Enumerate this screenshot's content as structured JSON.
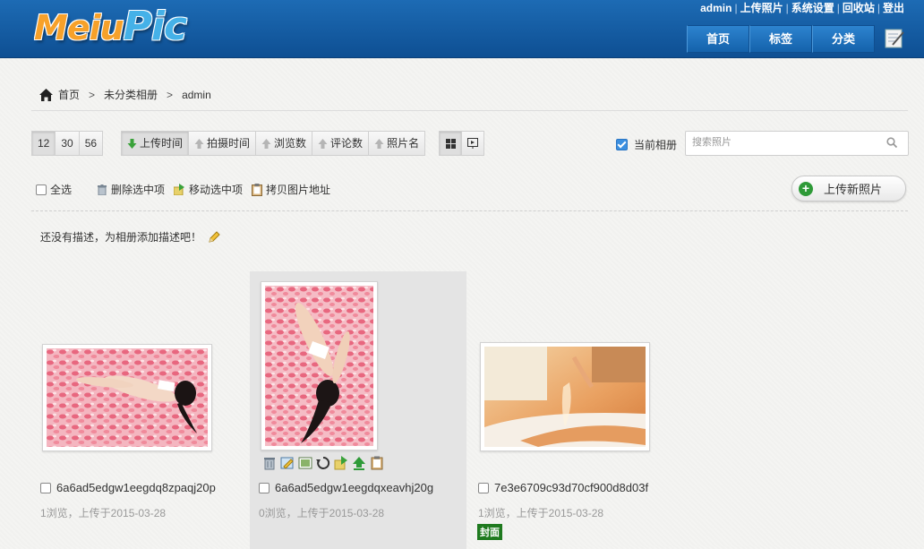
{
  "app": {
    "logo_part1": "Meiu",
    "logo_part2": "Pic"
  },
  "toplinks": [
    "admin",
    "上传照片",
    "系统设置",
    "回收站",
    "登出"
  ],
  "nav": [
    "首页",
    "标签",
    "分类"
  ],
  "breadcrumb": {
    "home": "首页",
    "category": "未分类相册",
    "current": "admin"
  },
  "page_sizes": [
    "12",
    "30",
    "56"
  ],
  "sort_buttons": [
    "上传时间",
    "拍摄时间",
    "浏览数",
    "评论数",
    "照片名"
  ],
  "current_album_label": "当前相册",
  "search_placeholder": "搜索照片",
  "actions": {
    "select_all": "全选",
    "delete": "删除选中项",
    "move": "移动选中项",
    "copy": "拷贝图片地址"
  },
  "upload_button": "上传新照片",
  "description": "还没有描述，为相册添加描述吧！",
  "photos": [
    {
      "name": "6a6ad5edgw1eegdq8zpaqj20p",
      "meta": "1浏览，上传于2015-03-28"
    },
    {
      "name": "6a6ad5edgw1eegdqxeavhj20g",
      "meta": "0浏览，上传于2015-03-28"
    },
    {
      "name": "7e3e6709c93d70cf900d8d03f",
      "meta": "1浏览，上传于2015-03-28",
      "badge": "封面"
    }
  ],
  "colors": {
    "header": "#1563ab",
    "cover_badge": "#1f7a1f",
    "plus_green": "#2e9a38"
  }
}
